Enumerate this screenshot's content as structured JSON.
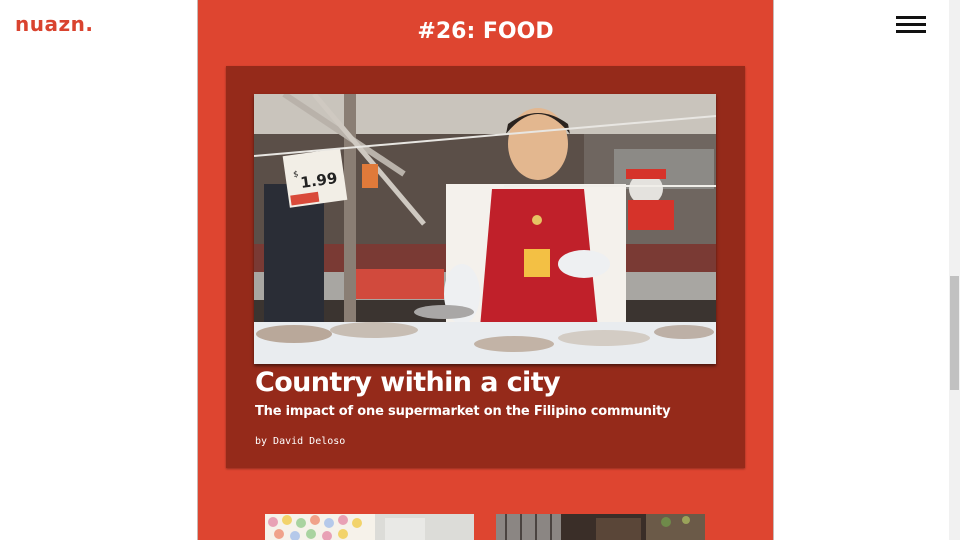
{
  "header": {
    "logo": "nuazn.",
    "menu_icon": "hamburger-menu-icon"
  },
  "issue": {
    "title": "#26: FOOD"
  },
  "feature": {
    "photo_price": "1.99",
    "photo_price_symbol": "$",
    "headline": "Country within a city",
    "subheadline": "The impact of one supermarket on the Filipino community",
    "byline": "by David Deloso"
  },
  "colors": {
    "brand": "#d9432f",
    "panel": "#de4530",
    "card": "#952a1a"
  }
}
